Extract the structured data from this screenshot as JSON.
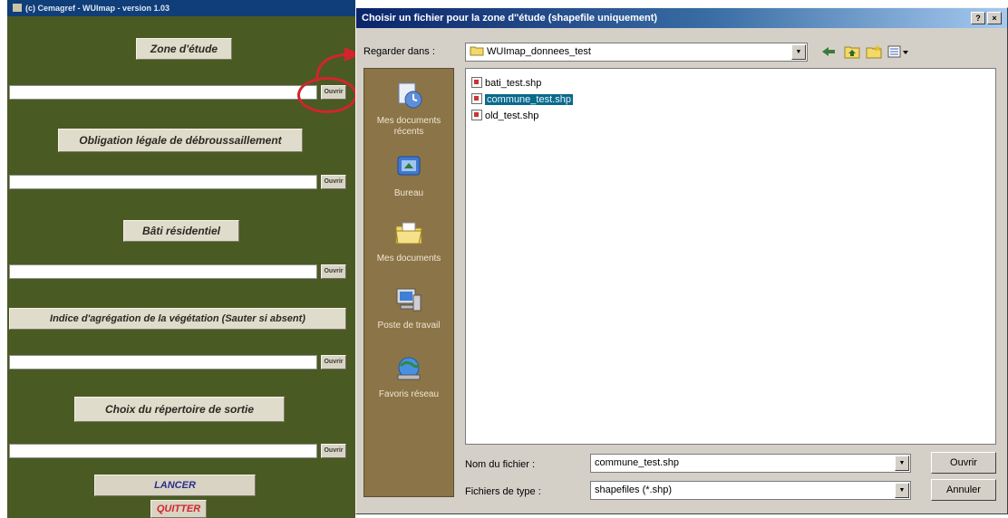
{
  "main_window": {
    "title": "(c) Cemagref - WUImap - version 1.03",
    "sections": [
      {
        "label": "Zone d'étude",
        "button": "Ouvrir"
      },
      {
        "label": "Obligation légale de débroussaillement",
        "button": "Ouvrir"
      },
      {
        "label": "Bâti résidentiel",
        "button": "Ouvrir"
      },
      {
        "label": "Indice d'agrégation de la végétation (Sauter si absent)",
        "button": "Ouvrir"
      },
      {
        "label": "Choix du répertoire de sortie",
        "button": "Ouvrir"
      }
    ],
    "launch_button": "LANCER",
    "quit_button": "QUITTER",
    "colors": {
      "background": "#4a5a23",
      "launch_text": "#2b2e8c",
      "quit_text": "#d3242b",
      "annotation": "#d3242b"
    }
  },
  "dialog": {
    "title": "Choisir un fichier pour la zone d''étude (shapefile uniquement)",
    "help_button": "?",
    "close_button": "×",
    "look_in_label": "Regarder dans :",
    "look_in_value": "WUImap_donnees_test",
    "places": [
      {
        "label": "Mes documents récents",
        "icon": "recent-documents-icon"
      },
      {
        "label": "Bureau",
        "icon": "desktop-icon"
      },
      {
        "label": "Mes documents",
        "icon": "my-documents-icon"
      },
      {
        "label": "Poste de travail",
        "icon": "my-computer-icon"
      },
      {
        "label": "Favoris réseau",
        "icon": "network-places-icon"
      }
    ],
    "files": [
      "bati_test.shp",
      "commune_test.shp",
      "old_test.shp"
    ],
    "selected_file": "commune_test.shp",
    "filename_label": "Nom du fichier :",
    "filename_value": "commune_test.shp",
    "filetype_label": "Fichiers de type :",
    "filetype_value": "shapefiles (*.shp)",
    "open_button": "Ouvrir",
    "cancel_button": "Annuler"
  }
}
